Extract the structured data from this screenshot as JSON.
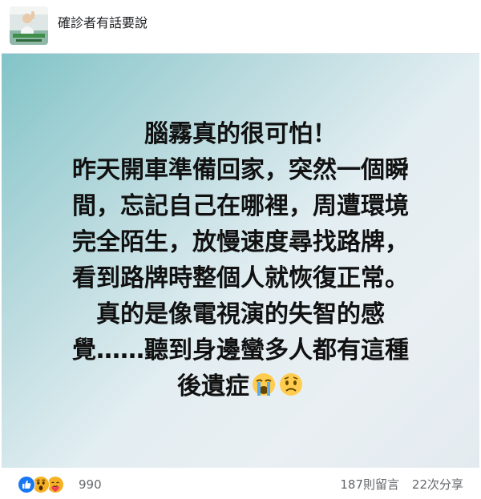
{
  "page": {
    "name": "確診者有話要說"
  },
  "post": {
    "lines": [
      "腦霧真的很可怕！",
      "昨天開車準備回家，突然一個瞬",
      "間，忘記自己在哪裡，周遭環境",
      "完全陌生，放慢速度尋找路牌，",
      "看到路牌時整個人就恢復正常。",
      "真的是像電視演的失智的感",
      "覺……聽到身邊蠻多人都有這種",
      "後遺症"
    ],
    "trailing_emojis": [
      "loudly-crying-face-emoji",
      "sad-face-emoji"
    ],
    "background_colors": [
      "#82c4c8",
      "#e9eff3"
    ]
  },
  "footer": {
    "reaction_icons": [
      "like-icon",
      "wow-icon",
      "care-icon"
    ],
    "reaction_count": "990",
    "comments": "187則留言",
    "shares": "22次分享"
  },
  "colors": {
    "like_blue": "#1877f2",
    "reaction_yellow": "#f7b125",
    "meta_text": "#65676b"
  }
}
